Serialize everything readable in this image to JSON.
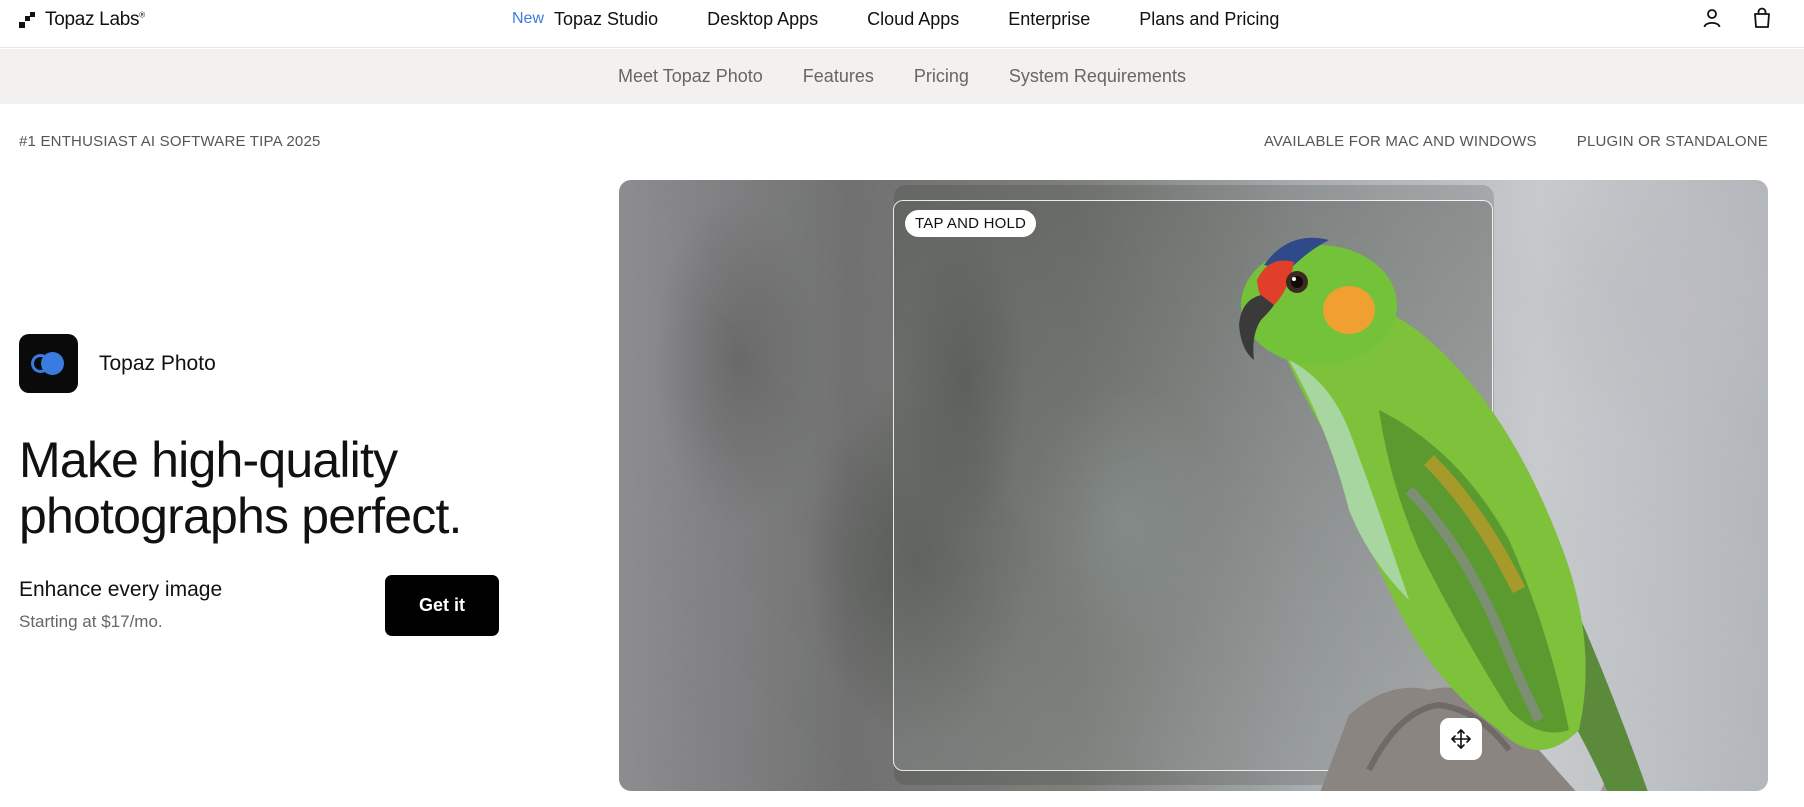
{
  "header": {
    "logo_text": "Topaz Labs",
    "logo_mark": "®",
    "new_badge": "New",
    "nav": [
      {
        "label": "Topaz Studio"
      },
      {
        "label": "Desktop Apps"
      },
      {
        "label": "Cloud Apps"
      },
      {
        "label": "Enterprise"
      },
      {
        "label": "Plans and Pricing"
      }
    ],
    "icons": [
      "user-icon",
      "shopping-bag-icon"
    ]
  },
  "subnav": {
    "items": [
      {
        "label": "Meet Topaz Photo"
      },
      {
        "label": "Features"
      },
      {
        "label": "Pricing"
      },
      {
        "label": "System Requirements"
      }
    ]
  },
  "tags": {
    "left": "#1 ENTHUSIAST AI SOFTWARE TIPA 2025",
    "right": [
      "AVAILABLE FOR MAC AND WINDOWS",
      "PLUGIN OR STANDALONE"
    ]
  },
  "hero": {
    "app_name": "Topaz Photo",
    "headline_line1": "Make high-quality",
    "headline_line2": "photographs perfect.",
    "subtitle": "Enhance every image",
    "price_note": "Starting at $17/mo.",
    "cta_label": "Get it"
  },
  "comparison": {
    "pill_label": "TAP AND HOLD",
    "handle_icon": "move-arrows-icon"
  },
  "colors": {
    "accent": "#3b7ddd",
    "cta_bg": "#000000",
    "subnav_bg": "#f2f1ef"
  }
}
